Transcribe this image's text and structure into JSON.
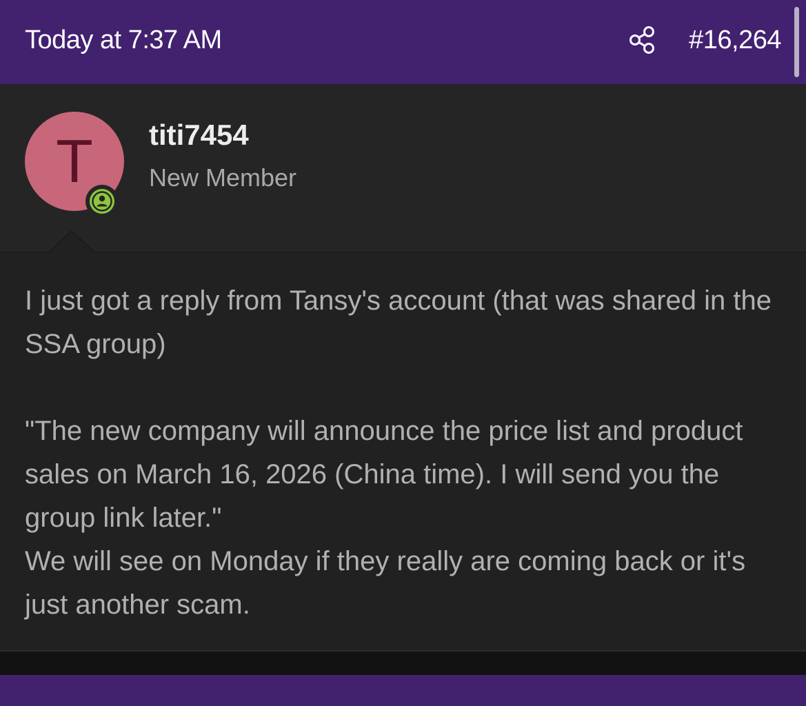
{
  "post": {
    "date": "Today at 7:37 AM",
    "number": "#16,264",
    "share_icon": "share-icon"
  },
  "user": {
    "avatar_letter": "T",
    "avatar_color": "#c8677a",
    "username": "titi7454",
    "title": "New Member",
    "status_icon": "online-user-icon",
    "status_color": "#8cc63f"
  },
  "message": {
    "text": "I just got a reply from Tansy's account (that was shared in the SSA group)\n\n\"The new company will announce the price list and product sales on March 16, 2026 (China time). I will send you the group link later.\"\nWe will see on Monday if they really are coming back or it's just another scam."
  },
  "colors": {
    "header": "#42216f",
    "background": "#232323"
  }
}
